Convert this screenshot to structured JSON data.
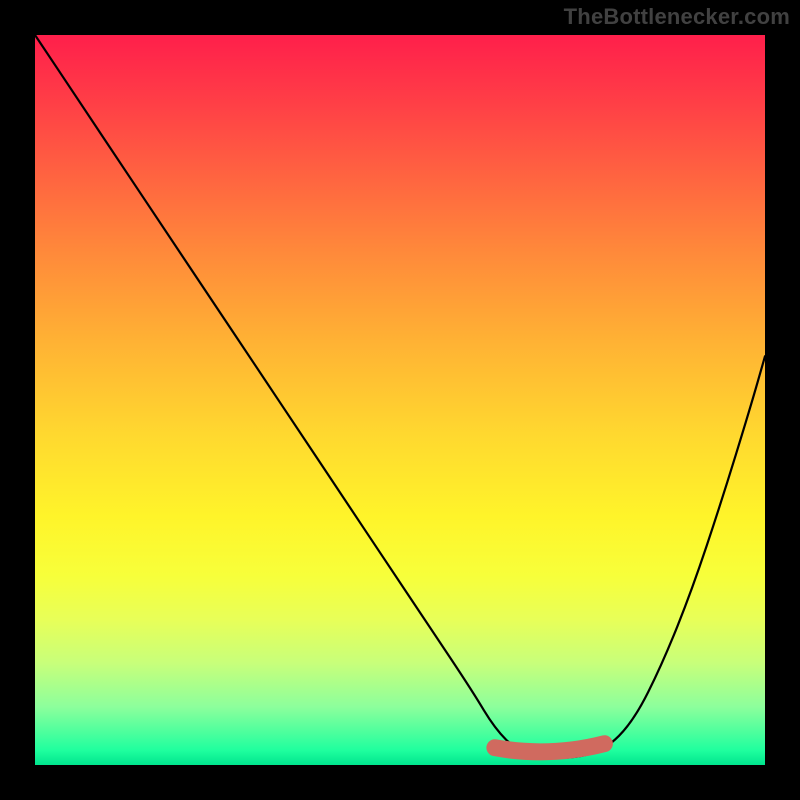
{
  "watermark": "TheBottlenecker.com",
  "colors": {
    "frame": "#000000",
    "watermark_text": "#414141",
    "curve": "#000000",
    "trough_marker": "#d06a5f"
  },
  "chart_data": {
    "type": "line",
    "title": "",
    "xlabel": "",
    "ylabel": "",
    "xlim": [
      0,
      100
    ],
    "ylim": [
      0,
      100
    ],
    "grid": false,
    "legend": false,
    "background_gradient": {
      "orientation": "vertical",
      "stops": [
        {
          "pos": 0.0,
          "color": "#ff1f4b"
        },
        {
          "pos": 0.55,
          "color": "#ffd92f"
        },
        {
          "pos": 0.92,
          "color": "#8dff9c"
        },
        {
          "pos": 1.0,
          "color": "#00e58e"
        }
      ],
      "note": "red=high bottleneck, green=low bottleneck"
    },
    "series": [
      {
        "name": "bottleneck-curve",
        "x": [
          0,
          6,
          12,
          18,
          24,
          30,
          36,
          42,
          48,
          54,
          60,
          63,
          66,
          70,
          74,
          78,
          82,
          86,
          90,
          94,
          98,
          100
        ],
        "y": [
          100,
          91,
          82,
          73,
          64,
          55,
          46,
          37,
          28,
          19,
          10,
          5,
          2,
          1,
          1,
          2,
          6,
          14,
          24,
          36,
          49,
          56
        ]
      }
    ],
    "trough_marker": {
      "x_range": [
        63,
        78
      ],
      "y_approx": 1
    }
  }
}
